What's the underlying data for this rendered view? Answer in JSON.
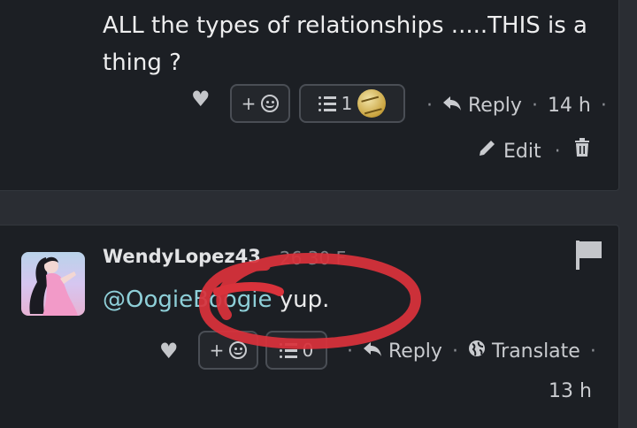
{
  "comment1": {
    "text": "ALL the types of relationships .....THIS is a thing ?",
    "add_reaction_label": "+",
    "reactions_count": "1",
    "reply_label": "Reply",
    "time": "14 h",
    "edit_label": "Edit"
  },
  "comment2": {
    "username": "WendyLopez43",
    "faint_meta": "26 30 F",
    "mention": "@OogieBoogie",
    "text": " yup.",
    "add_reaction_label": "+",
    "reactions_count": "0",
    "reply_label": "Reply",
    "translate_label": "Translate",
    "time": "13 h"
  },
  "colors": {
    "background": "#2a2d33",
    "card": "#1c1f24",
    "mention": "#8ecfd8",
    "annotation_red": "#d9323b"
  },
  "icons": [
    "heart-icon",
    "smiley-icon",
    "list-icon",
    "reply-arrow-icon",
    "pencil-icon",
    "trash-icon",
    "flag-icon",
    "globe-icon"
  ]
}
